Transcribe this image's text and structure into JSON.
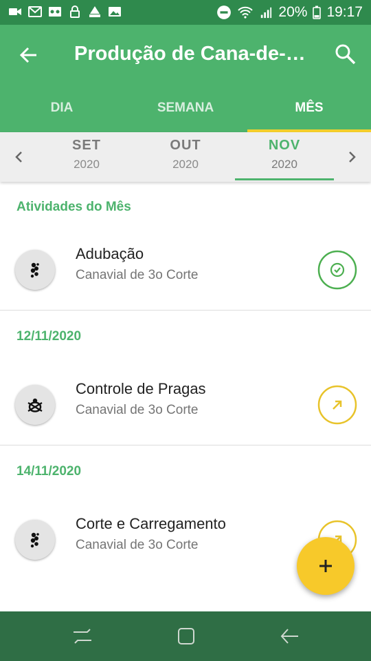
{
  "status_bar": {
    "battery": "20%",
    "time": "19:17",
    "left_icons": [
      "camera-icon",
      "gmail-icon",
      "voicemail-icon",
      "lock-icon",
      "signal-mm-icon",
      "image-icon"
    ],
    "right_icons": [
      "do-not-disturb-icon",
      "wifi-icon",
      "signal-icon",
      "battery-icon"
    ]
  },
  "app_bar": {
    "title": "Produção de Cana-de-A...",
    "back_icon": "arrow-back-icon",
    "search_icon": "search-icon"
  },
  "tabs": [
    {
      "label": "DIA",
      "active": false
    },
    {
      "label": "SEMANA",
      "active": false
    },
    {
      "label": "MÊS",
      "active": true
    }
  ],
  "months": [
    {
      "month": "SET",
      "year": "2020",
      "active": false
    },
    {
      "month": "OUT",
      "year": "2020",
      "active": false
    },
    {
      "month": "NOV",
      "year": "2020",
      "active": true
    }
  ],
  "sections": [
    {
      "header": "Atividades do Mês",
      "items": [
        {
          "title": "Adubação",
          "subtitle": "Canavial de 3o Corte",
          "icon": "fertilizer-icon",
          "status": "done",
          "status_icon": "check-circle-icon"
        }
      ]
    },
    {
      "header": "12/11/2020",
      "items": [
        {
          "title": "Controle de Pragas",
          "subtitle": "Canavial de 3o Corte",
          "icon": "bug-icon",
          "status": "pending",
          "status_icon": "arrow-up-right-icon"
        }
      ]
    },
    {
      "header": "14/11/2020",
      "items": [
        {
          "title": "Corte e Carregamento",
          "subtitle": "Canavial de 3o Corte",
          "icon": "fertilizer-icon",
          "status": "pending",
          "status_icon": "arrow-up-right-icon"
        }
      ]
    }
  ],
  "fab": {
    "label": "+",
    "icon": "add-icon"
  },
  "colors": {
    "primary": "#4db36d",
    "primary_dark": "#2f8a4d",
    "accent": "#f5cf2a",
    "done": "#4caf50",
    "pending": "#e8c32a"
  }
}
